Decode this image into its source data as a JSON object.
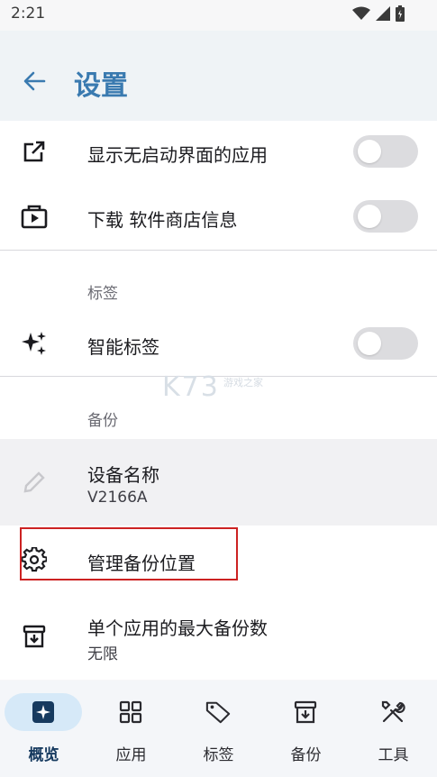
{
  "status": {
    "time": "2:21"
  },
  "header": {
    "title": "设置"
  },
  "rows": {
    "no_launch_apps": "显示无启动界面的应用",
    "download_store_info": "下载 软件商店信息",
    "smart_tags": "智能标签",
    "device_name": {
      "title": "设备名称",
      "value": "V2166A"
    },
    "manage_backup_location": "管理备份位置",
    "max_backups": {
      "title": "单个应用的最大备份数",
      "value": "无限"
    }
  },
  "sections": {
    "tags": "标签",
    "backup": "备份"
  },
  "toggles": {
    "no_launch_apps": false,
    "download_store_info": false,
    "smart_tags": false
  },
  "watermark": {
    "text": "K73",
    "sub": "游戏之家"
  },
  "bottom_nav": [
    {
      "label": "概览",
      "icon": "overview-icon",
      "active": true
    },
    {
      "label": "应用",
      "icon": "apps-grid-icon",
      "active": false
    },
    {
      "label": "标签",
      "icon": "tag-icon",
      "active": false
    },
    {
      "label": "备份",
      "icon": "backup-archive-icon",
      "active": false
    },
    {
      "label": "工具",
      "icon": "tools-icon",
      "active": false
    }
  ],
  "colors": {
    "accent": "#3a7ab0",
    "active_pill": "#d6e9f8",
    "highlight_border": "#cc2222"
  }
}
